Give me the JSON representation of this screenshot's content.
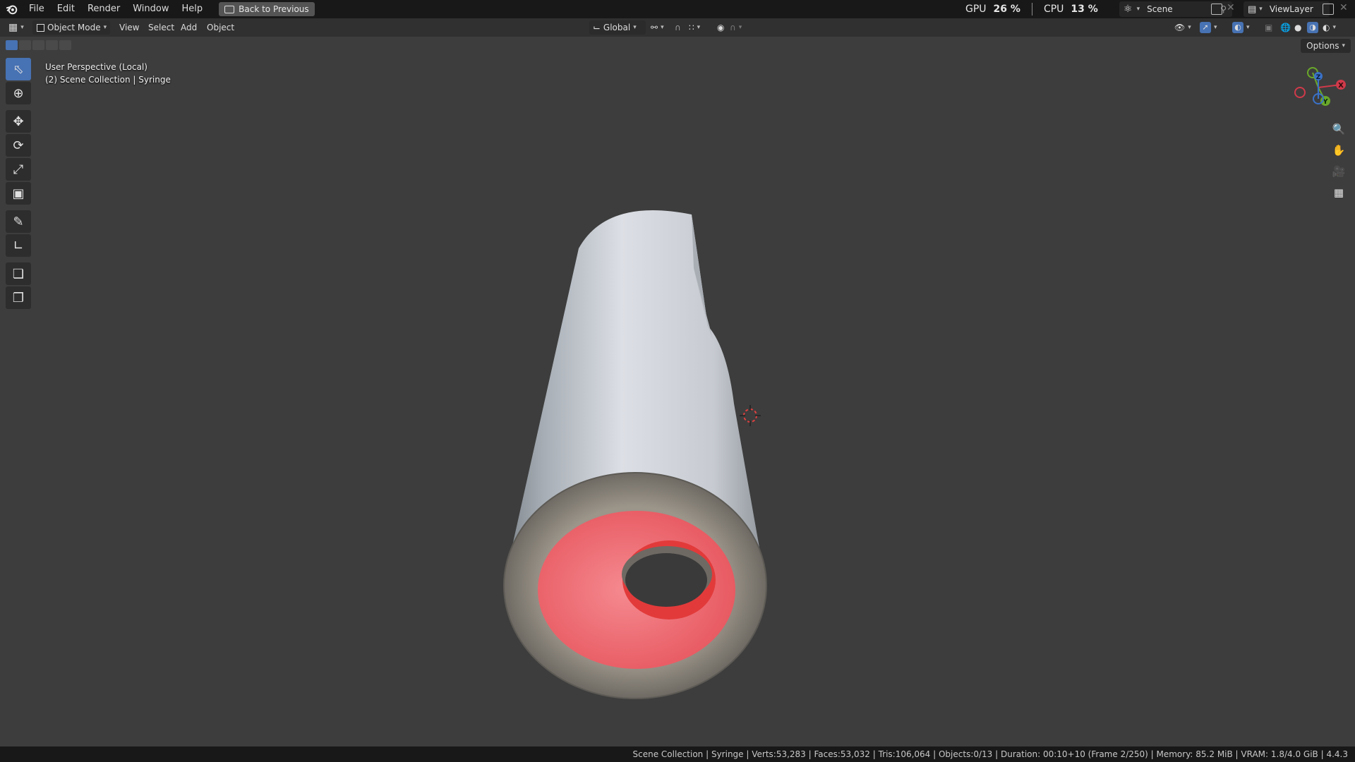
{
  "menubar": {
    "logo": "blender-logo-icon",
    "items": [
      "File",
      "Edit",
      "Render",
      "Window",
      "Help"
    ],
    "back_button": "Back to Previous"
  },
  "performance": {
    "gpu_label": "GPU",
    "gpu_value": "26 %",
    "cpu_label": "CPU",
    "cpu_value": "13 %"
  },
  "scene": {
    "name": "Scene"
  },
  "view_layer": {
    "name": "ViewLayer"
  },
  "viewport_header": {
    "mode": "Object Mode",
    "menus": [
      "View",
      "Select",
      "Add",
      "Object"
    ],
    "transform_orientation": "Global",
    "options_label": "Options"
  },
  "viewport": {
    "perspective_label": "User Perspective (Local)",
    "collection_label": "(2) Scene Collection | Syringe",
    "accent_color": "#4772b3"
  },
  "toolbar": {
    "tools": [
      "select-box",
      "cursor",
      "move",
      "rotate",
      "scale",
      "transform",
      "annotate",
      "measure",
      "add-cube",
      "add-object"
    ]
  },
  "gizmo": {
    "axes": [
      "X",
      "Y",
      "Z"
    ],
    "colors": {
      "x": "#d03a4a",
      "y": "#6aa82a",
      "z": "#3a72c8"
    }
  },
  "statusbar": {
    "text": "Scene Collection | Syringe | Verts:53,283 | Faces:53,032 | Tris:106,064 | Objects:0/13 | Duration: 00:10+10 (Frame 2/250) | Memory: 85.2 MiB | VRAM: 1.8/4.0 GiB | 4.4.3"
  }
}
